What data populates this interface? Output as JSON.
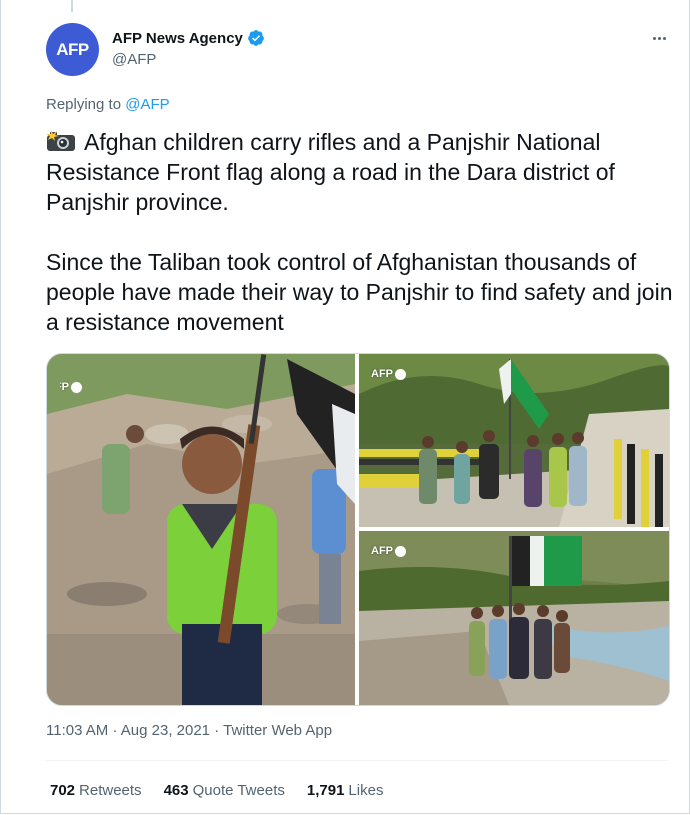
{
  "author": {
    "avatar_text": "AFP",
    "display_name": "AFP News Agency",
    "handle": "@AFP",
    "verified": true,
    "avatar_color": "#3e5bd6"
  },
  "replying": {
    "prefix": "Replying to",
    "mention": "@AFP"
  },
  "tweet": {
    "emoji_icon": "camera-with-flash-icon",
    "text": "Afghan children carry rifles and a Panjshir National Resistance Front flag along a road in the Dara district of Panjshir province.\n\nSince the Taliban took control of Afghanistan thousands of people have made their way to Panjshir to find safety and join a resistance movement"
  },
  "media": {
    "watermark": "AFP",
    "photos": 3
  },
  "meta": {
    "time": "11:03 AM",
    "date": "Aug 23, 2021",
    "source": "Twitter Web App"
  },
  "stats": {
    "retweets_count": "702",
    "retweets_label": "Retweets",
    "quotes_count": "463",
    "quotes_label": "Quote Tweets",
    "likes_count": "1,791",
    "likes_label": "Likes"
  },
  "colors": {
    "link": "#1d9bf0",
    "secondary_text": "#536471",
    "verified_badge": "#1d9bf0"
  }
}
